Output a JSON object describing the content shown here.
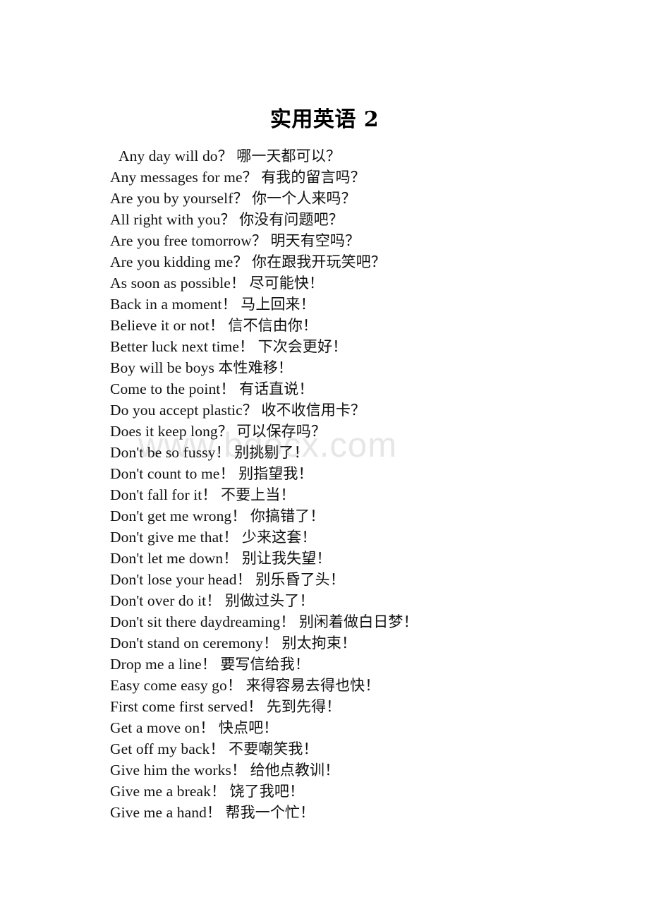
{
  "document": {
    "title": "实用英语 2",
    "watermark": "www.bdocx.com",
    "page_background": "#ffffff",
    "text_color": "#111111",
    "watermark_color": "#e6e6e6"
  },
  "phrases": [
    {
      "english": "Any day will do",
      "punct": "？",
      "chinese": "哪一天都可以？",
      "indent": true
    },
    {
      "english": "Any messages for me",
      "punct": "？",
      "chinese": "有我的留言吗？",
      "indent": false
    },
    {
      "english": "Are you by yourself",
      "punct": "？",
      "chinese": "你一个人来吗？",
      "indent": false
    },
    {
      "english": "All right with you",
      "punct": "？",
      "chinese": "你没有问题吧？",
      "indent": false
    },
    {
      "english": "Are you free tomorrow",
      "punct": "？",
      "chinese": "明天有空吗？",
      "indent": false
    },
    {
      "english": "Are you kidding me",
      "punct": "？",
      "chinese": "你在跟我开玩笑吧？",
      "indent": false
    },
    {
      "english": "As soon as possible",
      "punct": "！",
      "chinese": "尽可能快！",
      "indent": false
    },
    {
      "english": "Back in a moment",
      "punct": "！",
      "chinese": "马上回来！",
      "indent": false
    },
    {
      "english": "Believe it or not",
      "punct": "！",
      "chinese": "信不信由你！",
      "indent": false
    },
    {
      "english": "Better luck next time",
      "punct": "！",
      "chinese": "下次会更好！",
      "indent": false
    },
    {
      "english": "Boy will be boys",
      "punct": "",
      "chinese": "本性难移！",
      "indent": false
    },
    {
      "english": "Come to the point",
      "punct": "！",
      "chinese": "有话直说！",
      "indent": false
    },
    {
      "english": "Do you accept plastic",
      "punct": "？",
      "chinese": "收不收信用卡？",
      "indent": false
    },
    {
      "english": "Does it keep long",
      "punct": "？",
      "chinese": "可以保存吗？",
      "indent": false
    },
    {
      "english": "Don't be so fussy",
      "punct": "！",
      "chinese": "别挑剔了！",
      "indent": false
    },
    {
      "english": "Don't count to me",
      "punct": "！",
      "chinese": "别指望我！",
      "indent": false
    },
    {
      "english": "Don't fall for it",
      "punct": "！",
      "chinese": "不要上当！",
      "indent": false
    },
    {
      "english": "Don't get me wrong",
      "punct": "！",
      "chinese": "你搞错了！",
      "indent": false
    },
    {
      "english": "Don't give me that",
      "punct": "！",
      "chinese": "少来这套！",
      "indent": false
    },
    {
      "english": "Don't let me down",
      "punct": "！",
      "chinese": "别让我失望！",
      "indent": false
    },
    {
      "english": "Don't lose your head",
      "punct": "！",
      "chinese": "别乐昏了头！",
      "indent": false
    },
    {
      "english": "Don't over do it",
      "punct": "！",
      "chinese": "别做过头了！",
      "indent": false
    },
    {
      "english": "Don't sit there daydreaming",
      "punct": "！",
      "chinese": "别闲着做白日梦！",
      "indent": false
    },
    {
      "english": "Don't stand on ceremony",
      "punct": "！",
      "chinese": "别太拘束！",
      "indent": false
    },
    {
      "english": "Drop me a line",
      "punct": "！",
      "chinese": "要写信给我！",
      "indent": false
    },
    {
      "english": "Easy come easy go",
      "punct": "！",
      "chinese": "来得容易去得也快！",
      "indent": false
    },
    {
      "english": "First come first served",
      "punct": "！",
      "chinese": "先到先得！",
      "indent": false
    },
    {
      "english": "Get a move on",
      "punct": "！",
      "chinese": "快点吧！",
      "indent": false
    },
    {
      "english": "Get off my back",
      "punct": "！",
      "chinese": "不要嘲笑我！",
      "indent": false
    },
    {
      "english": "Give him the works",
      "punct": "！",
      "chinese": "给他点教训！",
      "indent": false
    },
    {
      "english": "Give me a break",
      "punct": "！",
      "chinese": "饶了我吧！",
      "indent": false
    },
    {
      "english": "Give me a hand",
      "punct": "！",
      "chinese": "帮我一个忙！",
      "indent": false
    }
  ]
}
